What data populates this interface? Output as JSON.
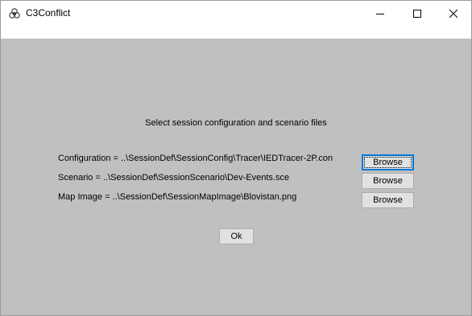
{
  "window": {
    "title": "C3Conflict",
    "icon": "celtic-knot-icon",
    "caption_buttons": [
      "minimize-icon",
      "maximize-icon",
      "close-icon"
    ]
  },
  "dialog": {
    "heading": "Select session configuration and scenario files",
    "rows": [
      {
        "label": "Configuration  =  ..\\SessionDef\\SessionConfig\\Tracer\\IEDTracer-2P.con",
        "button": "Browse"
      },
      {
        "label": "Scenario  =  ..\\SessionDef\\SessionScenario\\Dev-Events.sce",
        "button": "Browse"
      },
      {
        "label": "Map Image  =  ..\\SessionDef\\SessionMapImage\\Blovistan.png",
        "button": "Browse"
      }
    ],
    "ok_label": "Ok"
  },
  "colors": {
    "client_background": "#c0c0c0",
    "button_face": "#e1e1e1",
    "focus_accent": "#0078d7"
  }
}
